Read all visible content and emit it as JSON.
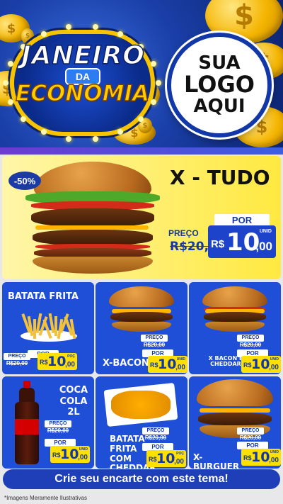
{
  "hero": {
    "title_line1": "JANEIRO",
    "title_line2": "DA",
    "title_line3": "ECONOMIA",
    "logo_text": [
      "SUA",
      "LOGO",
      "AQUI"
    ]
  },
  "featured": {
    "discount": "-50%",
    "name": "X - TUDO",
    "por_label": "POR",
    "preco_label": "PREÇO",
    "old_price": "R$20,00",
    "currency": "R$",
    "price_int": "10",
    "price_dec": ",00",
    "unit": "UNID"
  },
  "products": [
    {
      "name": "BATATA FRITA",
      "preco": "PREÇO",
      "old": "R$20,00",
      "por": "POR",
      "cur": "R$",
      "int": "10",
      "dec": ",00",
      "unit": "POÇ"
    },
    {
      "name": "X-BACON",
      "preco": "PREÇO",
      "old": "R$20,00",
      "por": "POR",
      "cur": "R$",
      "int": "10",
      "dec": ",00",
      "unit": "UNID"
    },
    {
      "name": "X BACON E CHEDDAR",
      "preco": "PREÇO",
      "old": "R$20,00",
      "por": "POR",
      "cur": "R$",
      "int": "10",
      "dec": ",00",
      "unit": "UNID"
    },
    {
      "name": "COCA COLA 2L",
      "preco": "PREÇO",
      "old": "R$20,00",
      "por": "POR",
      "cur": "R$",
      "int": "10",
      "dec": ",00",
      "unit": "UNID"
    },
    {
      "name": "BATATA FRITA COM CHEDDAR",
      "preco": "PREÇO",
      "old": "R$20,00",
      "por": "POR",
      "cur": "R$",
      "int": "10",
      "dec": ",00",
      "unit": "POÇ"
    },
    {
      "name": "X-BURGUER",
      "preco": "PREÇO",
      "old": "R$20,00",
      "por": "POR",
      "cur": "R$",
      "int": "10",
      "dec": ",00",
      "unit": "UNID"
    }
  ],
  "cta": "Crie seu encarte com este tema!",
  "footnote": "*Imagens Meramente Ilustrativas",
  "colors": {
    "brand_blue": "#1f4fd6",
    "accent_yellow": "#ffe000"
  }
}
